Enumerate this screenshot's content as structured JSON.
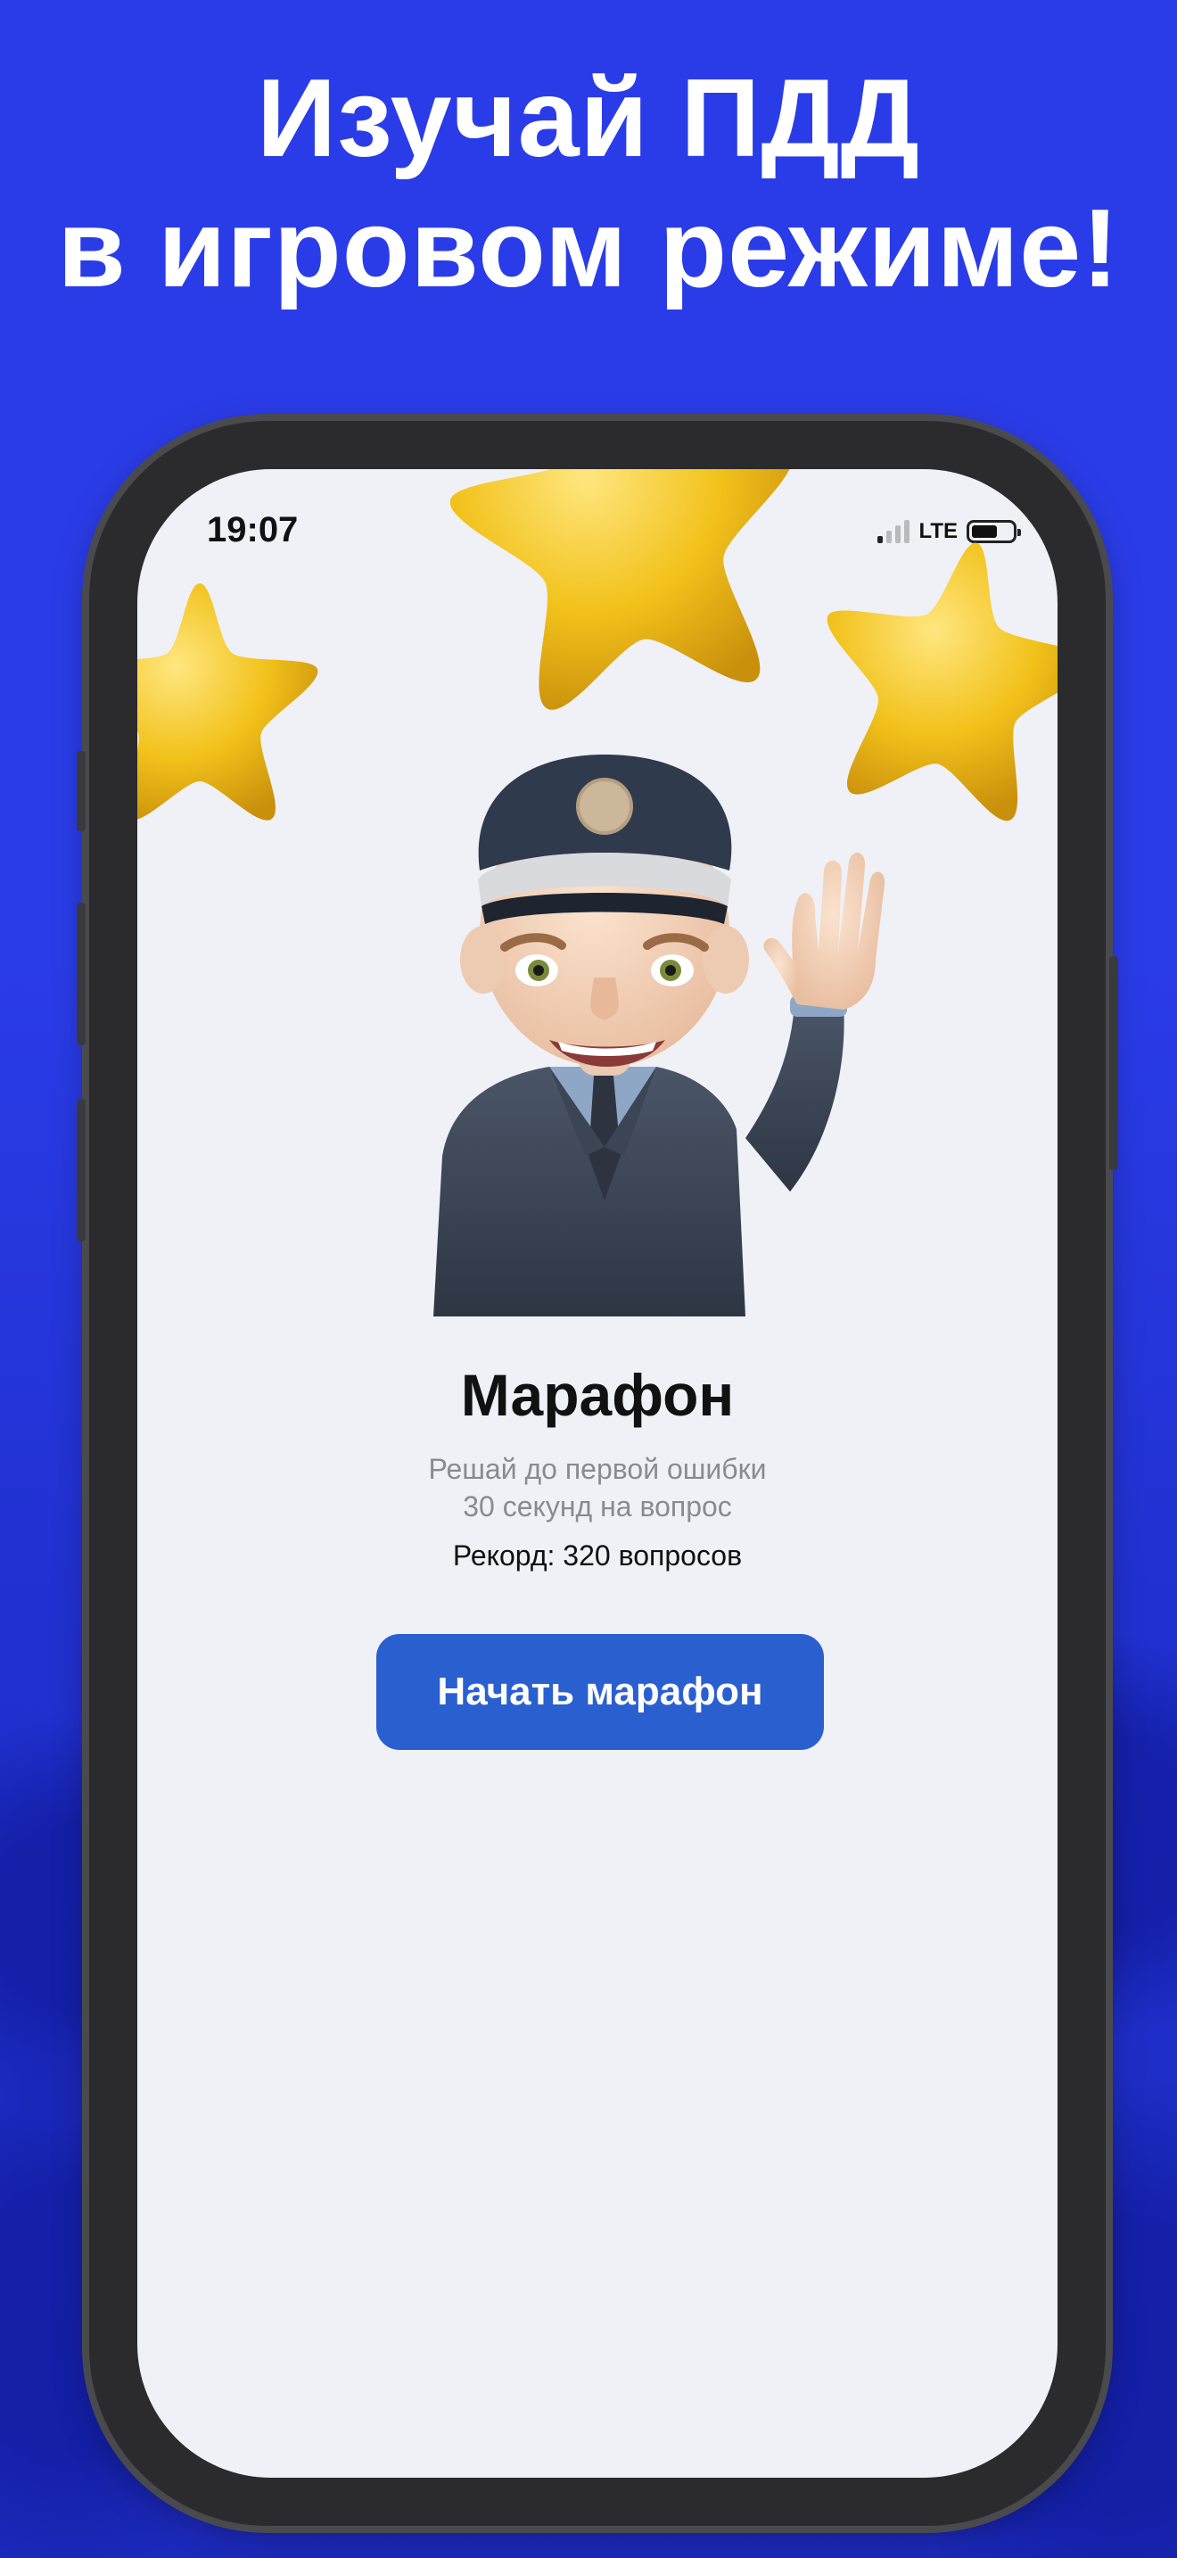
{
  "promo": {
    "headline_line1": "Изучай ПДД",
    "headline_line2": "в игровом режиме!"
  },
  "status_bar": {
    "time": "19:07",
    "network": "LTE"
  },
  "icons": [
    "star-icon",
    "mascot-officer-icon",
    "signal-icon",
    "battery-icon"
  ],
  "colors": {
    "background": "#2a3ce8",
    "screen": "#f0f1f6",
    "button": "#2a5fd0",
    "star": "#f2c21b"
  },
  "marathon": {
    "title": "Марафон",
    "subtitle_line1": "Решай до первой ошибки",
    "subtitle_line2": "30 секунд на вопрос",
    "record": "Рекорд: 320 вопросов",
    "start_button": "Начать марафон"
  }
}
